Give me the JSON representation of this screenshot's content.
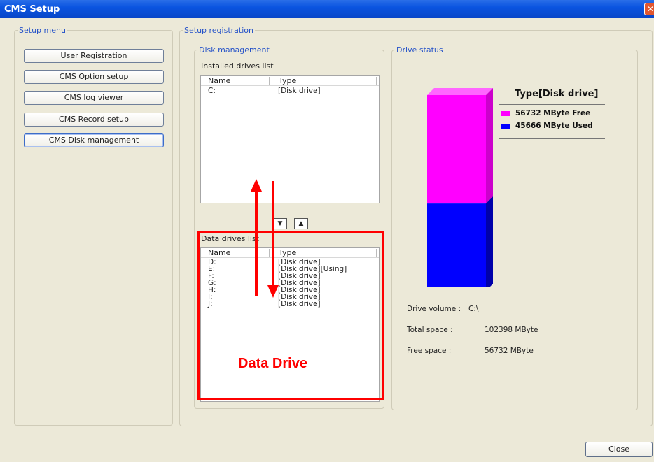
{
  "window": {
    "title": "CMS Setup",
    "close_glyph": "✕"
  },
  "setup_menu": {
    "legend": "Setup menu",
    "buttons": [
      "User Registration",
      "CMS Option setup",
      "CMS log viewer",
      "CMS Record setup",
      "CMS Disk management"
    ]
  },
  "registration": {
    "legend": "Setup registration"
  },
  "disk_management": {
    "legend": "Disk management",
    "installed_label": "Installed drives list",
    "columns": [
      "Name",
      "Type"
    ],
    "installed": [
      {
        "name": "C:",
        "type": "[Disk drive]"
      }
    ],
    "move_down": "▼",
    "move_up": "▲",
    "data_label": "Data drives list",
    "data_drives": [
      {
        "name": "D:",
        "type": "[Disk drive]"
      },
      {
        "name": "E:",
        "type": "[Disk drive][Using]"
      },
      {
        "name": "F:",
        "type": "[Disk drive]"
      },
      {
        "name": "G:",
        "type": "[Disk drive]"
      },
      {
        "name": "H:",
        "type": "[Disk drive]"
      },
      {
        "name": "I:",
        "type": "[Disk drive]"
      },
      {
        "name": "J:",
        "type": "[Disk drive]"
      }
    ]
  },
  "drive_status": {
    "legend": "Drive status",
    "chart_title": "Type[Disk drive]",
    "free_label": "56732 MByte Free",
    "used_label": "45666 MByte Used",
    "free_mb": 56732,
    "used_mb": 45666,
    "free_color": "#ff00ff",
    "used_color": "#0000ff",
    "volume_label": "Drive volume :",
    "volume_value": "C:\\",
    "total_label": "Total space :",
    "total_value": "102398 MByte",
    "free_space_label": "Free space :",
    "free_space_value": "56732 MByte"
  },
  "annotation": {
    "text": "Data Drive",
    "color": "#ff0000"
  },
  "close_button": "Close"
}
